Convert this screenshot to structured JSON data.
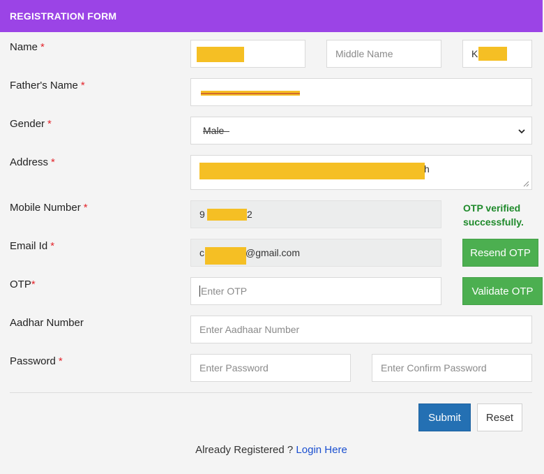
{
  "header": {
    "title": "REGISTRATION FORM"
  },
  "form": {
    "name": {
      "label": "Name",
      "required_mark": "*",
      "middle_placeholder": "Middle Name",
      "last_name_visible": "K"
    },
    "father_name": {
      "label": "Father's Name",
      "required_mark": "*"
    },
    "gender": {
      "label": "Gender",
      "required_mark": "*",
      "selected": "Male"
    },
    "address": {
      "label": "Address",
      "required_mark": "*",
      "visible_tail": "h"
    },
    "mobile": {
      "label": "Mobile Number",
      "required_mark": "*",
      "visible_start": "9",
      "visible_end": "2",
      "status": "OTP verified successfully."
    },
    "email": {
      "label": "Email Id",
      "required_mark": "*",
      "visible_start": "c",
      "visible_end": "@gmail.com",
      "resend_label": "Resend OTP"
    },
    "otp": {
      "label": "OTP",
      "required_mark": "*",
      "placeholder": "Enter OTP",
      "validate_label": "Validate OTP"
    },
    "aadhar": {
      "label": "Aadhar Number",
      "placeholder": "Enter Aadhaar Number"
    },
    "password": {
      "label": "Password",
      "required_mark": "*",
      "placeholder": "Enter Password",
      "confirm_placeholder": "Enter Confirm Password"
    }
  },
  "actions": {
    "submit_label": "Submit",
    "reset_label": "Reset"
  },
  "footer": {
    "text": "Already Registered ? ",
    "link": "Login Here"
  },
  "colors": {
    "header_bg": "#9b44e6",
    "button_green": "#4caf50",
    "button_blue": "#2470b3",
    "success_text": "#1f8a2b",
    "required_mark": "#e3242b",
    "redaction": "#f5bf24"
  }
}
